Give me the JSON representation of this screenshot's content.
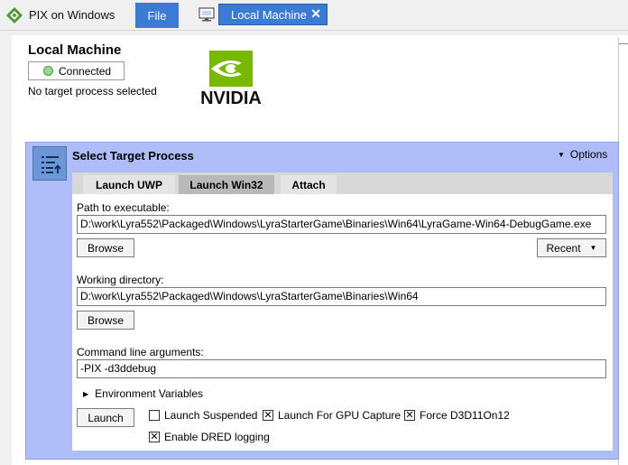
{
  "titlebar": {
    "app_title": "PIX on Windows",
    "file_label": "File",
    "tab_label": "Local Machine",
    "tab_close": "✕"
  },
  "machine": {
    "title": "Local Machine",
    "status_label": "Connected",
    "target_info": "No target process selected"
  },
  "logo": {
    "text": "NVIDIA"
  },
  "panel": {
    "title": "Select Target Process",
    "options_caret": "▼",
    "options_label": "Options"
  },
  "tabs": [
    {
      "label": "Launch UWP"
    },
    {
      "label": "Launch Win32"
    },
    {
      "label": "Attach"
    }
  ],
  "form": {
    "path_label": "Path to executable:",
    "path_value": "D:\\work\\Lyra552\\Packaged\\Windows\\LyraStarterGame\\Binaries\\Win64\\LyraGame-Win64-DebugGame.exe",
    "browse_label": "Browse",
    "recent_label": "Recent",
    "recent_caret": "▼",
    "workdir_label": "Working directory:",
    "workdir_value": "D:\\work\\Lyra552\\Packaged\\Windows\\LyraStarterGame\\Binaries\\Win64",
    "args_label": "Command line arguments:",
    "args_value": "-PIX -d3ddebug",
    "env_caret": "▶",
    "env_label": "Environment Variables",
    "launch_label": "Launch",
    "checks": [
      {
        "label": "Launch Suspended",
        "checked": false,
        "mark": ""
      },
      {
        "label": "Launch For GPU Capture",
        "checked": true,
        "mark": "✕"
      },
      {
        "label": "Force D3D11On12",
        "checked": true,
        "mark": "✕"
      },
      {
        "label": "Enable DRED logging",
        "checked": true,
        "mark": "✕"
      }
    ]
  },
  "colors": {
    "accent": "#3a7bd5",
    "panel_bg": "#aebdf7",
    "status_green": "#9bd78c",
    "nvidia_green": "#76b900"
  }
}
